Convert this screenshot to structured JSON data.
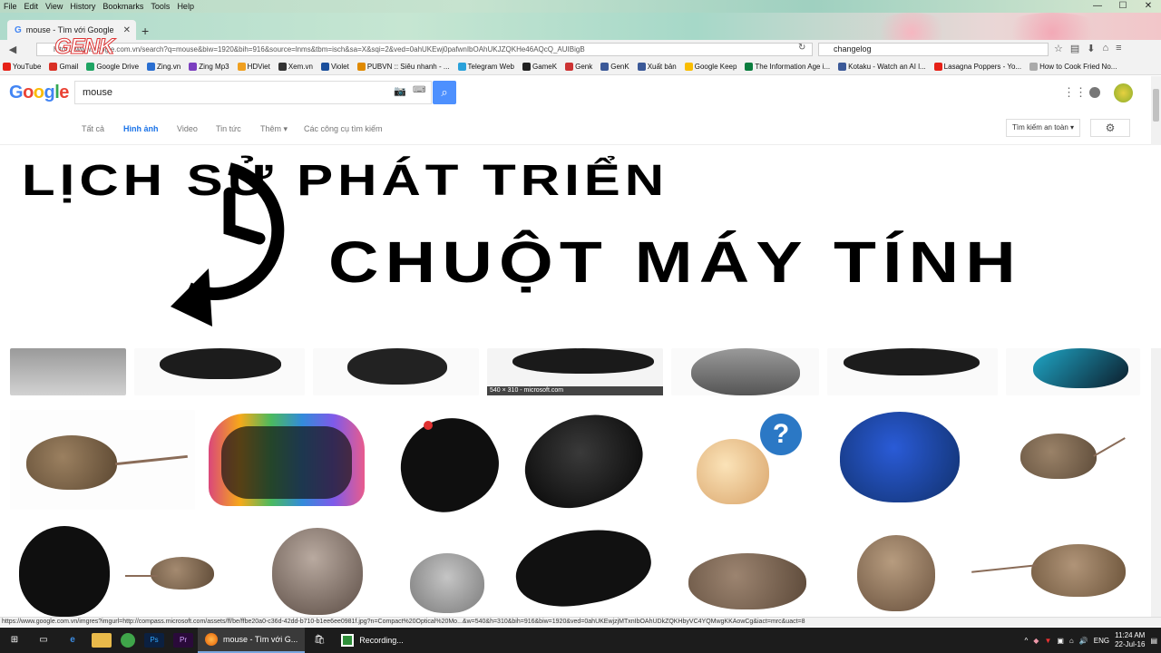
{
  "menu": [
    "File",
    "Edit",
    "View",
    "History",
    "Bookmarks",
    "Tools",
    "Help"
  ],
  "tab": {
    "title": "mouse - Tìm với Google",
    "new_tab": "+"
  },
  "url": "https://www.google.com.vn/search?q=mouse&biw=1920&bih=916&source=lnms&tbm=isch&sa=X&sqi=2&ved=0ahUKEwj0pafwnIbOAhUKJZQKHe46AQcQ_AUIBigB",
  "overlay_logo": "GENK",
  "browser_search": "changelog",
  "bookmarks": [
    {
      "label": "YouTube",
      "color": "#e62117"
    },
    {
      "label": "Gmail",
      "color": "#d93025"
    },
    {
      "label": "Google Drive",
      "color": "#1fa463"
    },
    {
      "label": "Zing.vn",
      "color": "#2a6fd1"
    },
    {
      "label": "Zing Mp3",
      "color": "#7b3fbf"
    },
    {
      "label": "HDViet",
      "color": "#f0a020"
    },
    {
      "label": "Xem.vn",
      "color": "#333"
    },
    {
      "label": "Violet",
      "color": "#1b4f9c"
    },
    {
      "label": "PUBVN :: Siêu nhanh - ...",
      "color": "#e08a00"
    },
    {
      "label": "Telegram Web",
      "color": "#2aa1da"
    },
    {
      "label": "GameK",
      "color": "#222"
    },
    {
      "label": "Genk",
      "color": "#c33"
    },
    {
      "label": "GenK",
      "color": "#3b5998"
    },
    {
      "label": "Xuất bản",
      "color": "#3b5998"
    },
    {
      "label": "Google Keep",
      "color": "#f9bd00"
    },
    {
      "label": "The Information Age i...",
      "color": "#0a7d3e"
    },
    {
      "label": "Kotaku - Watch an AI l...",
      "color": "#3b5998"
    },
    {
      "label": "Lasagna Poppers - Yo...",
      "color": "#e62117"
    },
    {
      "label": "How to Cook Fried No...",
      "color": "#aaa"
    }
  ],
  "google": {
    "query": "mouse",
    "tabs": [
      "Tất cả",
      "Hình ảnh",
      "Video",
      "Tin tức",
      "Thêm ▾",
      "Các công cụ tìm kiếm"
    ],
    "safe_search": "Tìm kiếm an toàn ▾",
    "size_caption": "540 × 310 - microsoft.com"
  },
  "overlay": {
    "line1": "LỊCH SỬ PHÁT TRIỂN",
    "line2": "CHUỘT MÁY TÍNH"
  },
  "status_url": "https://www.google.com.vn/imgres?imgurl=http://compass.microsoft.com/assets/ff/be/ffbe20a0-c36d-42dd-b710-b1ee6ee0981f.jpg?n=Compact%20Optical%20Mo...&w=540&h=310&bih=916&biw=1920&ved=0ahUKEwjzjMTxnIbOAhUDkZQKHbyVC4YQMwgKKAowCg&iact=mrc&uact=8",
  "taskbar": {
    "apps": [
      {
        "label": "mouse - Tìm với G...",
        "active": true
      },
      {
        "label": "Recording...",
        "active": false
      }
    ],
    "lang": "ENG",
    "time": "11:24 AM",
    "date": "22-Jul-16"
  }
}
